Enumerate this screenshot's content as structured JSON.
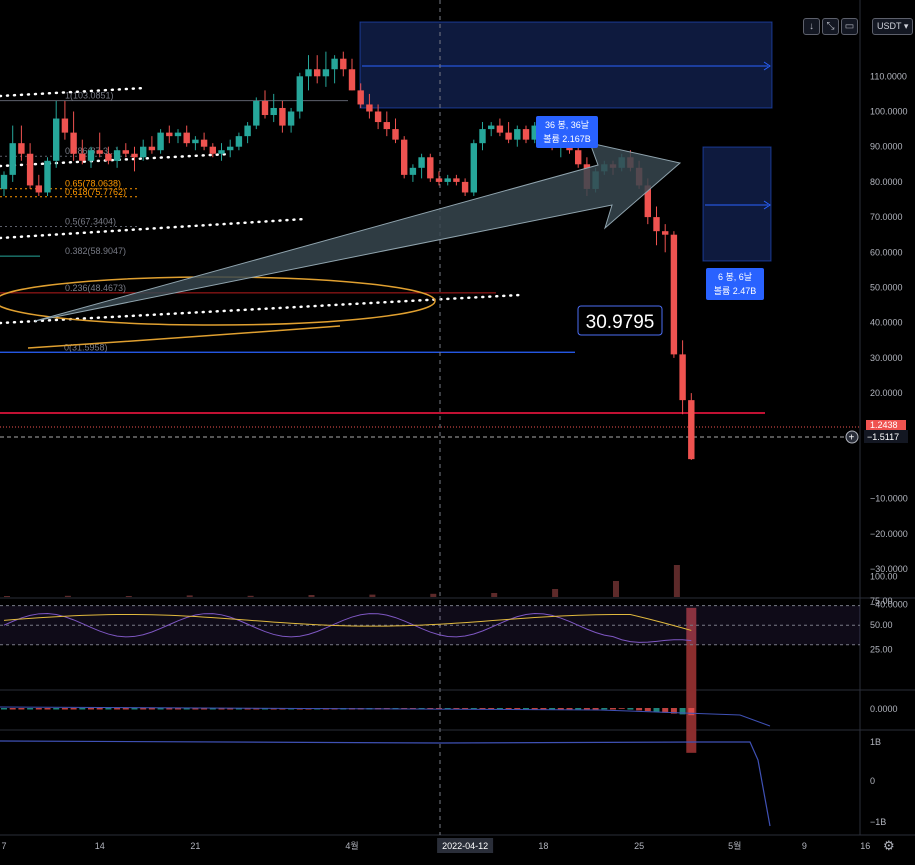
{
  "toolbar": {
    "currency": "USDT",
    "currency_caret": "▾",
    "down_icon": "↓",
    "collapse_icon": "⤡",
    "maximize_icon": "▭",
    "settings_icon": "⚙"
  },
  "colors": {
    "up": "#26a69a",
    "down": "#ef5350",
    "fib": "#5d606b",
    "zone": "#1e3a8a",
    "label_bg": "#2962ff",
    "price_label_border": "#4c6ef5",
    "rsi": "#7e57c2",
    "rsi_ma": "#e0b93e",
    "obv": "#3f51b5"
  },
  "chart_data": {
    "type": "candlestick",
    "price_axis": {
      "ticks": [
        110,
        100,
        90,
        80,
        70,
        60,
        50,
        40,
        30,
        20,
        10,
        -10,
        -20,
        -30,
        -40
      ],
      "tick_labels": [
        "110.0000",
        "100.0000",
        "90.0000",
        "80.0000",
        "70.0000",
        "60.0000",
        "50.0000",
        "40.0000",
        "30.0000",
        "20.0000",
        "10.0000",
        "−10.0000",
        "−20.0000",
        "−30.0000",
        "−40.0000"
      ],
      "last_price_label": "1.2438",
      "cursor_price_label": "−1.5117",
      "ylim": [
        -44,
        118
      ]
    },
    "time_axis": {
      "labels": [
        "7",
        "14",
        "21",
        "4월",
        "2022-04-12",
        "18",
        "25",
        "5월",
        "9",
        "16"
      ],
      "label_index": [
        0,
        11,
        22,
        40,
        53,
        62,
        73,
        84,
        92,
        99
      ]
    },
    "candles": [
      {
        "o": 78,
        "h": 83,
        "l": 76,
        "c": 82
      },
      {
        "o": 82,
        "h": 96,
        "l": 80,
        "c": 91
      },
      {
        "o": 91,
        "h": 96,
        "l": 86,
        "c": 88
      },
      {
        "o": 88,
        "h": 91,
        "l": 78,
        "c": 79
      },
      {
        "o": 79,
        "h": 82,
        "l": 76,
        "c": 77
      },
      {
        "o": 77,
        "h": 87,
        "l": 76,
        "c": 86
      },
      {
        "o": 86,
        "h": 103,
        "l": 84,
        "c": 98
      },
      {
        "o": 98,
        "h": 103,
        "l": 92,
        "c": 94
      },
      {
        "o": 94,
        "h": 100,
        "l": 86,
        "c": 88
      },
      {
        "o": 88,
        "h": 92,
        "l": 85,
        "c": 86
      },
      {
        "o": 86,
        "h": 90,
        "l": 84,
        "c": 89
      },
      {
        "o": 89,
        "h": 94,
        "l": 87,
        "c": 88
      },
      {
        "o": 88,
        "h": 90,
        "l": 85,
        "c": 86
      },
      {
        "o": 86,
        "h": 90,
        "l": 84,
        "c": 89
      },
      {
        "o": 89,
        "h": 91,
        "l": 87,
        "c": 88
      },
      {
        "o": 88,
        "h": 90,
        "l": 83,
        "c": 87
      },
      {
        "o": 87,
        "h": 92,
        "l": 86,
        "c": 90
      },
      {
        "o": 90,
        "h": 93,
        "l": 88,
        "c": 89
      },
      {
        "o": 89,
        "h": 95,
        "l": 88,
        "c": 94
      },
      {
        "o": 94,
        "h": 96,
        "l": 91,
        "c": 93
      },
      {
        "o": 93,
        "h": 95,
        "l": 91,
        "c": 94
      },
      {
        "o": 94,
        "h": 96,
        "l": 90,
        "c": 91
      },
      {
        "o": 91,
        "h": 93,
        "l": 89,
        "c": 92
      },
      {
        "o": 92,
        "h": 94,
        "l": 89,
        "c": 90
      },
      {
        "o": 90,
        "h": 91,
        "l": 87,
        "c": 88
      },
      {
        "o": 88,
        "h": 91,
        "l": 86,
        "c": 89
      },
      {
        "o": 89,
        "h": 92,
        "l": 87,
        "c": 90
      },
      {
        "o": 90,
        "h": 94,
        "l": 89,
        "c": 93
      },
      {
        "o": 93,
        "h": 97,
        "l": 91,
        "c": 96
      },
      {
        "o": 96,
        "h": 104,
        "l": 95,
        "c": 103
      },
      {
        "o": 103,
        "h": 106,
        "l": 98,
        "c": 99
      },
      {
        "o": 99,
        "h": 105,
        "l": 97,
        "c": 101
      },
      {
        "o": 101,
        "h": 103,
        "l": 94,
        "c": 96
      },
      {
        "o": 96,
        "h": 101,
        "l": 94,
        "c": 100
      },
      {
        "o": 100,
        "h": 111,
        "l": 98,
        "c": 110
      },
      {
        "o": 110,
        "h": 116,
        "l": 106,
        "c": 112
      },
      {
        "o": 112,
        "h": 116,
        "l": 108,
        "c": 110
      },
      {
        "o": 110,
        "h": 117,
        "l": 107,
        "c": 112
      },
      {
        "o": 112,
        "h": 116,
        "l": 108,
        "c": 115
      },
      {
        "o": 115,
        "h": 117,
        "l": 110,
        "c": 112
      },
      {
        "o": 112,
        "h": 115,
        "l": 106,
        "c": 106
      },
      {
        "o": 106,
        "h": 108,
        "l": 101,
        "c": 102
      },
      {
        "o": 102,
        "h": 105,
        "l": 98,
        "c": 100
      },
      {
        "o": 100,
        "h": 102,
        "l": 95,
        "c": 97
      },
      {
        "o": 97,
        "h": 100,
        "l": 93,
        "c": 95
      },
      {
        "o": 95,
        "h": 98,
        "l": 91,
        "c": 92
      },
      {
        "o": 92,
        "h": 93,
        "l": 81,
        "c": 82
      },
      {
        "o": 82,
        "h": 85,
        "l": 80,
        "c": 84
      },
      {
        "o": 84,
        "h": 88,
        "l": 81,
        "c": 87
      },
      {
        "o": 87,
        "h": 88,
        "l": 80,
        "c": 81
      },
      {
        "o": 81,
        "h": 83,
        "l": 79,
        "c": 80
      },
      {
        "o": 80,
        "h": 82,
        "l": 79,
        "c": 81
      },
      {
        "o": 81,
        "h": 82,
        "l": 79,
        "c": 80
      },
      {
        "o": 80,
        "h": 81,
        "l": 76,
        "c": 77
      },
      {
        "o": 77,
        "h": 92,
        "l": 76,
        "c": 91
      },
      {
        "o": 91,
        "h": 97,
        "l": 89,
        "c": 95
      },
      {
        "o": 95,
        "h": 97,
        "l": 93,
        "c": 96
      },
      {
        "o": 96,
        "h": 98,
        "l": 93,
        "c": 94
      },
      {
        "o": 94,
        "h": 97,
        "l": 91,
        "c": 92
      },
      {
        "o": 92,
        "h": 96,
        "l": 90,
        "c": 95
      },
      {
        "o": 95,
        "h": 96,
        "l": 91,
        "c": 92
      },
      {
        "o": 92,
        "h": 97,
        "l": 91,
        "c": 96
      },
      {
        "o": 96,
        "h": 98,
        "l": 94,
        "c": 97
      },
      {
        "o": 97,
        "h": 98,
        "l": 89,
        "c": 90
      },
      {
        "o": 90,
        "h": 93,
        "l": 87,
        "c": 90
      },
      {
        "o": 90,
        "h": 92,
        "l": 88,
        "c": 89
      },
      {
        "o": 89,
        "h": 90,
        "l": 84,
        "c": 85
      },
      {
        "o": 85,
        "h": 87,
        "l": 76,
        "c": 78
      },
      {
        "o": 78,
        "h": 84,
        "l": 77,
        "c": 83
      },
      {
        "o": 83,
        "h": 86,
        "l": 82,
        "c": 85
      },
      {
        "o": 85,
        "h": 86,
        "l": 82,
        "c": 84
      },
      {
        "o": 84,
        "h": 88,
        "l": 83,
        "c": 87
      },
      {
        "o": 87,
        "h": 89,
        "l": 83,
        "c": 84
      },
      {
        "o": 84,
        "h": 86,
        "l": 78,
        "c": 79
      },
      {
        "o": 79,
        "h": 81,
        "l": 68,
        "c": 70
      },
      {
        "o": 70,
        "h": 73,
        "l": 62,
        "c": 66
      },
      {
        "o": 66,
        "h": 68,
        "l": 60,
        "c": 65
      },
      {
        "o": 65,
        "h": 66,
        "l": 30,
        "c": 31
      },
      {
        "o": 31,
        "h": 35,
        "l": 14,
        "c": 18
      },
      {
        "o": 18,
        "h": 20,
        "l": 1,
        "c": 1.24
      }
    ],
    "candle_x_start": 4,
    "candle_x_step": 8.7,
    "fib_levels": [
      {
        "label": "1(103.0851)",
        "price": 103.0851
      },
      {
        "label": "0.786(87.3...)",
        "price": 87.3
      },
      {
        "label": "0.65(78.0638)",
        "price": 78.0638
      },
      {
        "label": "0.618(75.7762)",
        "price": 75.7762
      },
      {
        "label": "0.5(67.3404)",
        "price": 67.3404
      },
      {
        "label": "0.382(58.9047)",
        "price": 58.9047
      },
      {
        "label": "0.236(48.4673)",
        "price": 48.4673
      },
      {
        "label": "0(31.5958)",
        "price": 31.5958
      }
    ],
    "annotations": [
      {
        "line1": "36 봉, 36날",
        "line2": "볼륨 2.167B"
      },
      {
        "line1": "6 봉, 6날",
        "line2": "볼륨 2.47B"
      }
    ],
    "price_callout": "30.9795",
    "volume_bars": [
      0.2,
      0.3,
      0.2,
      0.4,
      0.3,
      0.5,
      0.6,
      0.8,
      1,
      2,
      4,
      8
    ],
    "volume_bar_last_value": -41,
    "rsi": {
      "ticks": [
        100,
        75,
        50,
        25
      ],
      "tick_labels": [
        "100.00",
        "75.00",
        "50.00",
        "25.00"
      ],
      "last_value": 16,
      "ma_last_value": 37
    },
    "macd": {
      "tick_label": "0.0000"
    },
    "obv": {
      "tick_labels": [
        "1B",
        "0",
        "−1B"
      ]
    }
  }
}
